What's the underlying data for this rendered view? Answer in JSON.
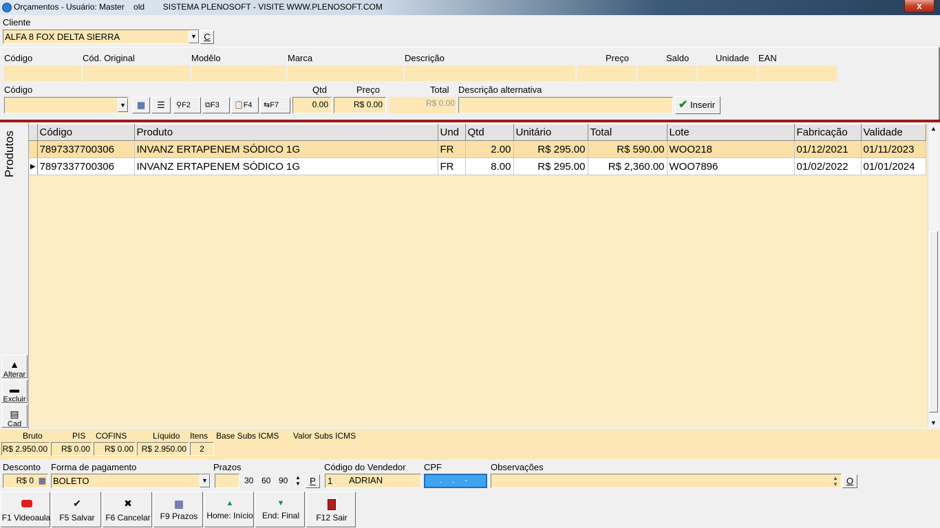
{
  "window": {
    "title": "Orçamentos - Usuário: Master    old        SISTEMA PLENOSOFT - VISITE WWW.PLENOSOFT.COM",
    "close_label": "x"
  },
  "client": {
    "label": "Cliente",
    "value": "ALFA 8 FOX DELTA SIERRA",
    "c_button": "C"
  },
  "product_info": {
    "headers": [
      "Código",
      "Cód. Original",
      "Modêlo",
      "Marca",
      "Descrição",
      "Preço",
      "Saldo",
      "Unidade",
      "EAN"
    ]
  },
  "entry": {
    "codigo_label": "Código",
    "qtd_label": "Qtd",
    "qtd_value": "0.00",
    "preco_label": "Preço",
    "preco_value": "R$ 0.00",
    "total_label": "Total",
    "total_value": "R$ 0.00",
    "desc_alt_label": "Descrição alternativa",
    "f2": "F2",
    "f3": "F3",
    "f4": "F4",
    "f7": "F7",
    "inserir_label": "Inserir"
  },
  "side": {
    "title": "Produtos",
    "alterar": "Alterar",
    "excluir": "Excluir",
    "cad": "Cad"
  },
  "grid": {
    "columns": [
      "Código",
      "Produto",
      "Und",
      "Qtd",
      "Unitário",
      "Total",
      "Lote",
      "Fabricação",
      "Validade"
    ],
    "rows": [
      [
        "7897337700306",
        "INVANZ ERTAPENEM SÓDICO 1G",
        "FR",
        "2.00",
        "R$ 295.00",
        "R$ 590.00",
        "WOO218",
        "01/12/2021",
        "01/11/2023"
      ],
      [
        "7897337700306",
        "INVANZ ERTAPENEM SÓDICO 1G",
        "FR",
        "8.00",
        "R$ 295.00",
        "R$ 2,360.00",
        "WOO7896",
        "01/02/2022",
        "01/01/2024"
      ]
    ]
  },
  "totals": {
    "bruto_label": "Bruto",
    "bruto": "R$ 2.950.00",
    "pis_label": "PIS",
    "pis": "R$ 0.00",
    "cofins_label": "COFINS",
    "cofins": "R$ 0.00",
    "liquido_label": "Líquido",
    "liquido": "R$ 2.950.00",
    "itens_label": "Itens",
    "itens": "2",
    "base_label": "Base Subs ICMS",
    "valor_label": "Valor Subs ICMS"
  },
  "payment": {
    "desconto_label": "Desconto",
    "desconto": "R$ 0",
    "forma_label": "Forma de pagamento",
    "forma": "BOLETO",
    "prazos_label": "Prazos",
    "prazo1": "30",
    "prazo2": "60",
    "prazo3": "90",
    "p_button": "P",
    "vendedor_label": "Código do Vendedor",
    "vendedor_code": "1",
    "vendedor_name": "ADRIAN",
    "cpf_label": "CPF",
    "cpf_mask": ". . -",
    "obs_label": "Observações",
    "o_button": "O"
  },
  "footer": {
    "buttons": [
      "F1 Videoaula",
      "F5 Salvar",
      "F6 Cancelar",
      "F9 Prazos",
      "Home: Início",
      "End: Final",
      "F12 Sair"
    ]
  },
  "colors": {
    "field": "#fde8b5",
    "grid_bg": "#fcedc6",
    "selected_row": "#fde0a6",
    "accent_red": "#9e1a1a",
    "check_green": "#1a8a1a"
  }
}
